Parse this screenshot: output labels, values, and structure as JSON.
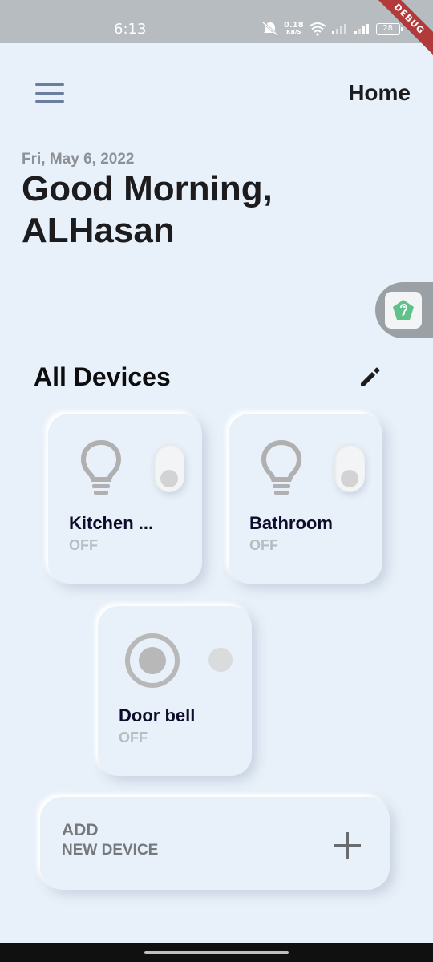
{
  "status_bar": {
    "time": "6:13",
    "speed_value": "0.18",
    "speed_unit": "KB/S",
    "battery": "28",
    "debug_label": "DEBUG"
  },
  "header": {
    "title": "Home",
    "menu_icon": "hamburger-menu-icon"
  },
  "greeting": {
    "date": "Fri, May 6, 2022",
    "message": "Good Morning,",
    "name": "ALHasan"
  },
  "devices_section": {
    "title": "All Devices",
    "edit_icon": "pencil-icon"
  },
  "devices": [
    {
      "name": "Kitchen ...",
      "state": "OFF",
      "icon": "lightbulb-icon",
      "on": false
    },
    {
      "name": "Bathroom",
      "state": "OFF",
      "icon": "lightbulb-icon",
      "on": false
    },
    {
      "name": "Door bell",
      "state": "OFF",
      "icon": "doorbell-icon",
      "on": false
    }
  ],
  "add_device": {
    "line1": "ADD",
    "line2": "NEW DEVICE",
    "icon": "plus-icon"
  },
  "colors": {
    "background": "#e8f0f9",
    "accent_menu": "#6c7ea0",
    "off_state": "#b7bcc2",
    "assistant_badge": "#5ec28a"
  }
}
